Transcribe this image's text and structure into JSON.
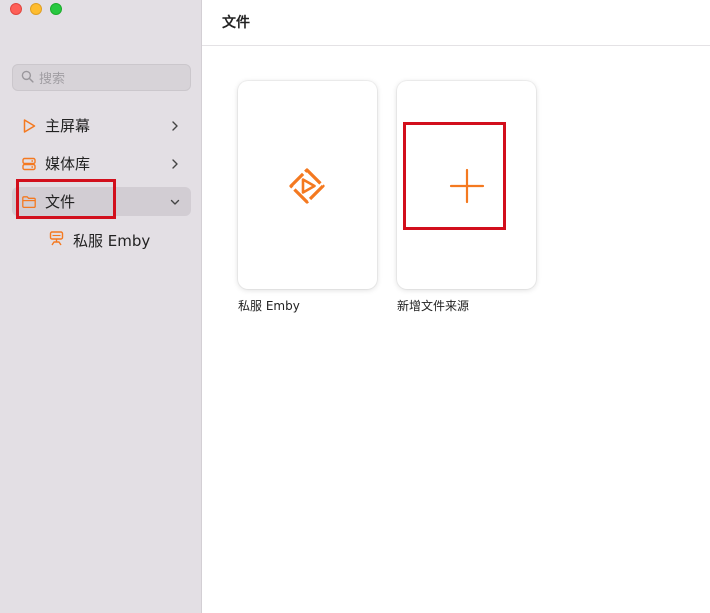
{
  "colors": {
    "accent": "#f47920",
    "sidebar_bg": "#e3dfe4",
    "selected_bg": "#d2cdd3",
    "highlight": "#d20f1c"
  },
  "sidebar": {
    "search": {
      "placeholder": "搜索",
      "icon": "search-icon"
    },
    "items": [
      {
        "label": "主屏幕",
        "icon": "play-icon",
        "chevron": "chevron-right-icon",
        "selected": false
      },
      {
        "label": "媒体库",
        "icon": "server-icon",
        "chevron": "chevron-right-icon",
        "selected": false
      },
      {
        "label": "文件",
        "icon": "folder-icon",
        "chevron": "chevron-down-icon",
        "selected": true
      }
    ],
    "sub_items": [
      {
        "label": "私服 Emby",
        "icon": "server-stack-icon"
      }
    ]
  },
  "main": {
    "title": "文件",
    "cards": [
      {
        "label": "私服 Emby",
        "icon": "emby-logo-icon"
      },
      {
        "label": "新增文件来源",
        "icon": "plus-icon"
      }
    ]
  }
}
